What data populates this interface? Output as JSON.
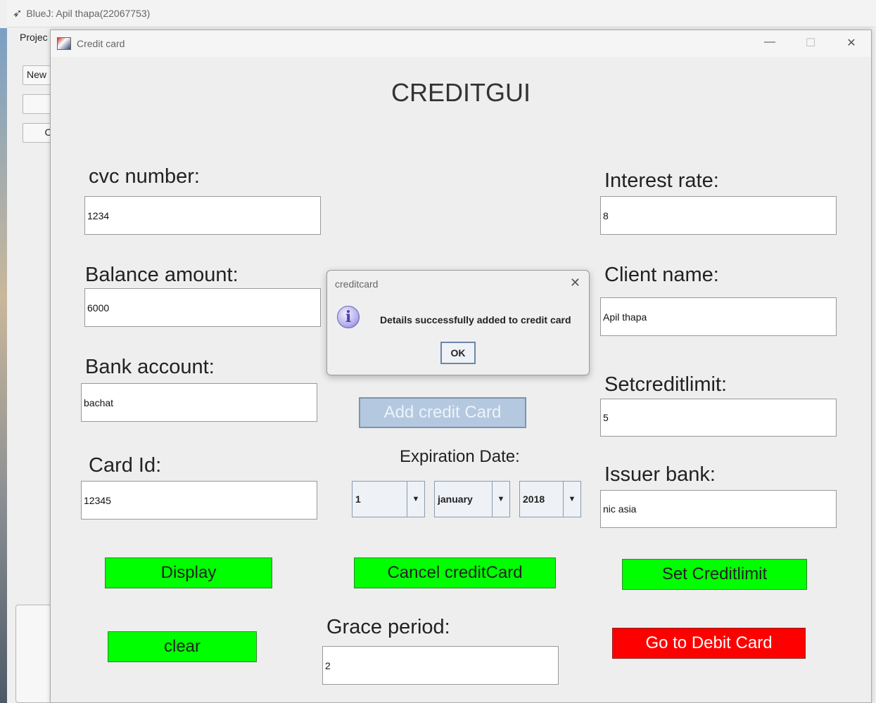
{
  "bluej": {
    "title": "BlueJ:  Apil thapa(22067753)",
    "menu_project": "Projec",
    "btn_new": "New",
    "btn_minus": "—",
    "btn_co": "Cor"
  },
  "window": {
    "title": "Credit card",
    "minimize": "—",
    "maximize": "☐",
    "close": "✕"
  },
  "form": {
    "heading": "CREDITGUI",
    "cvc_label": "cvc number:",
    "cvc_value": "1234",
    "interest_label": "Interest rate:",
    "interest_value": "8",
    "balance_label": "Balance amount:",
    "balance_value": "6000",
    "client_label": "Client name:",
    "client_value": "Apil thapa",
    "bank_label": "Bank account:",
    "bank_value": "bachat",
    "setcredit_label": "Setcreditlimit:",
    "setcredit_value": "5",
    "cardid_label": "Card Id:",
    "cardid_value": "12345",
    "expiration_label": "Expiration Date:",
    "exp_day": "1",
    "exp_month": "january",
    "exp_year": "2018",
    "issuer_label": "Issuer bank:",
    "issuer_value": "nic asia",
    "grace_label": "Grace period:",
    "grace_value": "2"
  },
  "buttons": {
    "add_credit": "Add credit Card",
    "display": "Display",
    "cancel": "Cancel creditCard",
    "set_limit": "Set Creditlimit",
    "clear": "clear",
    "go_debit": "Go to Debit Card"
  },
  "dialog": {
    "title": "creditcard",
    "close": "✕",
    "icon_glyph": "i",
    "message": "Details successfully added to credit card",
    "ok": "OK"
  },
  "colors": {
    "green_button": "#00ff00",
    "red_button": "#ff0000",
    "add_button": "#b4c8e0"
  }
}
